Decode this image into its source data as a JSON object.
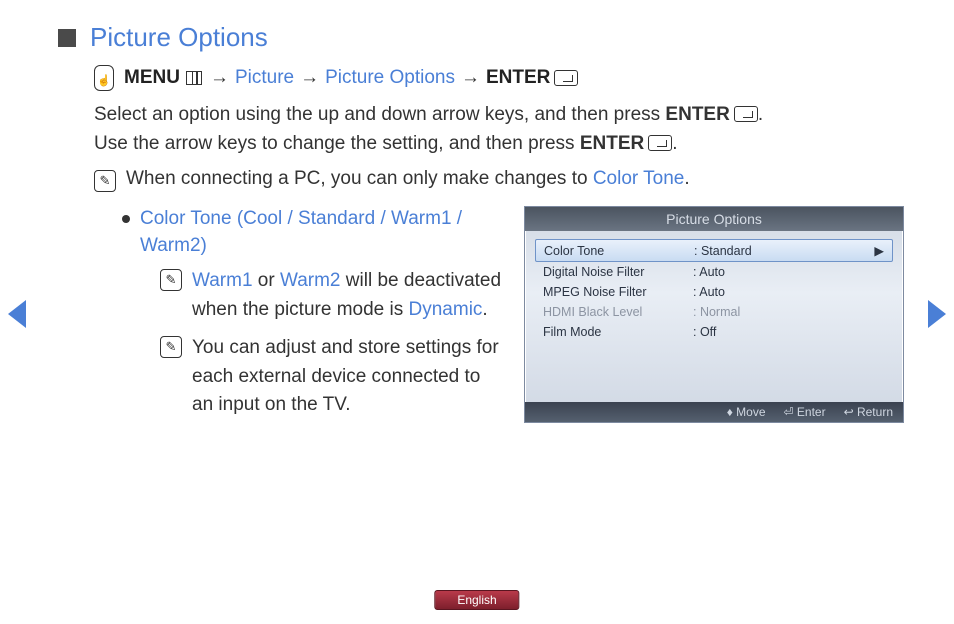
{
  "title": "Picture Options",
  "breadcrumb": {
    "menu_label": "MENU",
    "steps": [
      "Picture",
      "Picture Options"
    ],
    "enter_label": "ENTER"
  },
  "intro": {
    "line1_a": "Select an option using the up and down arrow keys, and then press ",
    "line1_b": "ENTER",
    "line1_c": ".",
    "line2_a": "Use the arrow keys to change the setting, and then press ",
    "line2_b": "ENTER",
    "line2_c": "."
  },
  "pc_note": {
    "text": " When connecting a PC, you can only make changes to ",
    "link": "Color Tone",
    "suffix": "."
  },
  "option": {
    "heading": "Color Tone (Cool / Standard / Warm1 / Warm2)",
    "note1_a": "Warm1",
    "note1_b": " or ",
    "note1_c": "Warm2",
    "note1_d": " will be deactivated when the picture mode is ",
    "note1_e": "Dynamic",
    "note1_f": ".",
    "note2": "You can adjust and store settings for each external device connected to an input on the TV."
  },
  "osd": {
    "title": "Picture Options",
    "rows": [
      {
        "label": "Color Tone",
        "value": "Standard",
        "selected": true
      },
      {
        "label": "Digital Noise Filter",
        "value": "Auto"
      },
      {
        "label": "MPEG Noise Filter",
        "value": "Auto"
      },
      {
        "label": "HDMI Black Level",
        "value": "Normal",
        "disabled": true
      },
      {
        "label": "Film Mode",
        "value": "Off"
      }
    ],
    "footer": {
      "move": "Move",
      "enter": "Enter",
      "return": "Return"
    }
  },
  "language": "English"
}
